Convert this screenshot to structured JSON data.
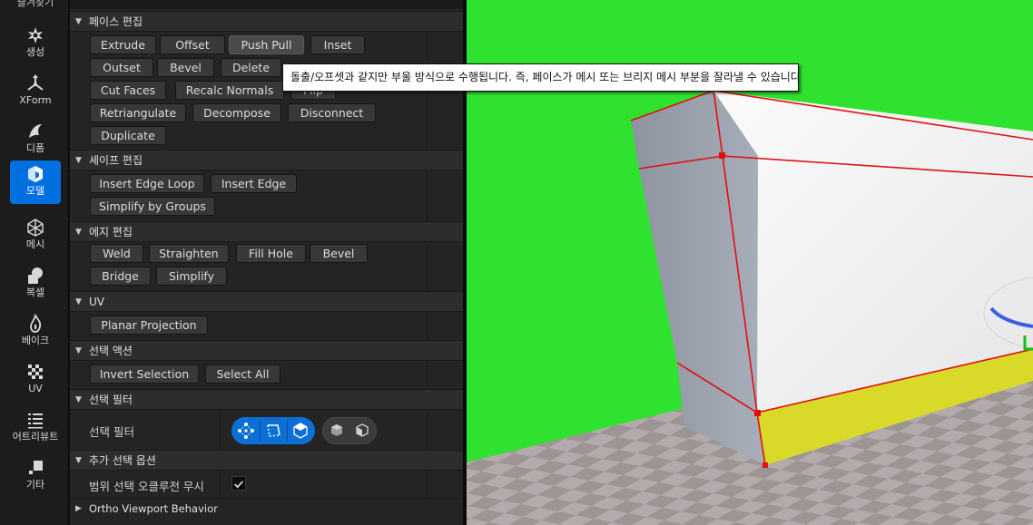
{
  "toolbar": {
    "partial_top_label": "즐겨찾기",
    "items": [
      {
        "label": "생성",
        "icon": "create-icon"
      },
      {
        "label": "XForm",
        "icon": "xform-icon"
      },
      {
        "label": "디폼",
        "icon": "deform-icon"
      },
      {
        "label": "모델",
        "icon": "model-icon",
        "active": true
      },
      {
        "label": "메시",
        "icon": "mesh-icon"
      },
      {
        "label": "복셀",
        "icon": "voxel-icon"
      },
      {
        "label": "베이크",
        "icon": "bake-icon"
      },
      {
        "label": "UV",
        "icon": "uv-icon"
      },
      {
        "label": "어트리뷰트",
        "icon": "attributes-icon"
      },
      {
        "label": "기타",
        "icon": "misc-icon"
      }
    ]
  },
  "sections": {
    "face_edit": {
      "title": "페이스 편집",
      "buttons": [
        "Extrude",
        "Offset",
        "Push Pull",
        "Inset",
        "Outset",
        "Bevel",
        "Delete",
        "Flip",
        "Cut Faces",
        "Recalc Normals",
        "Retriangulate",
        "Decompose",
        "Disconnect",
        "Duplicate"
      ]
    },
    "shape_edit": {
      "title": "셰이프 편집",
      "buttons": [
        "Insert Edge Loop",
        "Insert Edge",
        "Simplify by Groups"
      ]
    },
    "edge_edit": {
      "title": "에지 편집",
      "buttons": [
        "Weld",
        "Straighten",
        "Fill Hole",
        "Bevel",
        "Bridge",
        "Simplify"
      ]
    },
    "uv": {
      "title": "UV",
      "buttons": [
        "Planar Projection"
      ]
    },
    "selection_actions": {
      "title": "선택 액션",
      "buttons": [
        "Invert Selection",
        "Select All"
      ]
    },
    "selection_filter": {
      "title": "선택 필터",
      "row_label": "선택 필터",
      "filter_icons": [
        "vertex-select-icon",
        "edge-select-icon",
        "face-select-icon",
        "backface-icon",
        "occluded-icon"
      ]
    },
    "extra_selection": {
      "title": "추가 선택 옵션",
      "row_label": "범위 선택 오클루전 무시",
      "checked": true
    },
    "ortho": {
      "title": "Ortho Viewport Behavior"
    }
  },
  "tooltip": {
    "text": "돌출/오프셋과 같지만 부울 방식으로 수행됩니다. 즉, 페이스가 메시 또는 브리지 메시 부분을 잘라낼 수 있습니다."
  },
  "colors": {
    "accent": "#0c6fd6",
    "viewport_background": "#2ddf2d",
    "selection_edge": "#e01010",
    "highlight_face": "#d8d82a"
  }
}
